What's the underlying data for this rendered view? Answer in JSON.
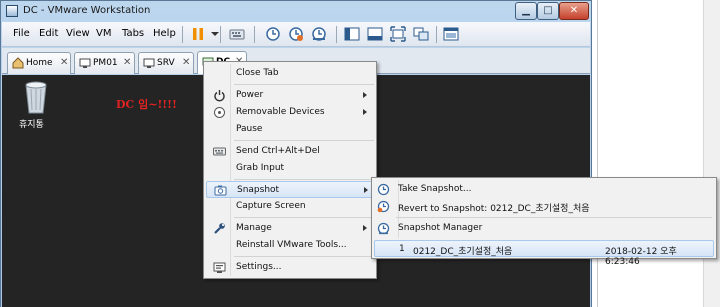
{
  "window": {
    "title": "DC - VMware Workstation"
  },
  "menubar": {
    "items": [
      "File",
      "Edit",
      "View",
      "VM",
      "Tabs",
      "Help"
    ]
  },
  "tabs": [
    {
      "label": "Home"
    },
    {
      "label": "PM01"
    },
    {
      "label": "SRV"
    },
    {
      "label": "DC"
    }
  ],
  "guest": {
    "recycle_label": "휴지통",
    "desktop_text": "DC 임~!!!!"
  },
  "context_menu": {
    "items": [
      {
        "label": "Close Tab",
        "icon": "none"
      },
      {
        "label": "Power",
        "icon": "power-icon",
        "submenu": true
      },
      {
        "label": "Removable Devices",
        "icon": "disc-icon",
        "submenu": true
      },
      {
        "label": "Pause",
        "icon": "none"
      },
      {
        "label": "Send Ctrl+Alt+Del",
        "icon": "keyboard-icon"
      },
      {
        "label": "Grab Input",
        "icon": "none"
      },
      {
        "label": "Snapshot",
        "icon": "snapshot-icon",
        "submenu": true
      },
      {
        "label": "Capture Screen",
        "icon": "none"
      },
      {
        "label": "Manage",
        "icon": "wrench-icon",
        "submenu": true
      },
      {
        "label": "Reinstall VMware Tools...",
        "icon": "none"
      },
      {
        "label": "Settings...",
        "icon": "settings-icon"
      }
    ]
  },
  "snapshot_menu": {
    "take": "Take Snapshot...",
    "revert": "Revert to Snapshot: 0212_DC_초기설정_처음",
    "manager": "Snapshot Manager",
    "entry": {
      "index": "1",
      "name": "0212_DC_초기설정_처음",
      "date": "2018-02-12 오후 6:23:46"
    }
  },
  "colors": {
    "accent": "#a8c8ec",
    "desktop_bg": "#242424",
    "guest_text": "#e32222"
  }
}
